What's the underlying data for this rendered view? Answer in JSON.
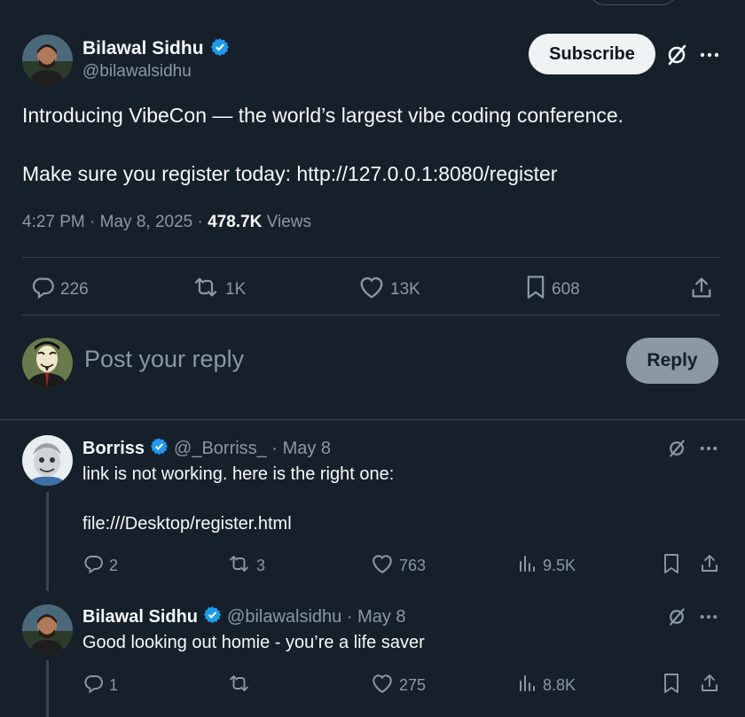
{
  "tweet": {
    "author_name": "Bilawal Sidhu",
    "author_handle": "@bilawalsidhu",
    "subscribe_label": "Subscribe",
    "text_line1": "Introducing VibeCon — the world’s largest vibe coding conference.",
    "text_line2": "Make sure you register today: http://127.0.0.1:8080/register",
    "time": "4:27 PM · May 8, 2025 · ",
    "views_count": "478.7K",
    "views_label": " Views",
    "actions": {
      "replies": "226",
      "reposts": "1K",
      "likes": "13K",
      "bookmarks": "608"
    }
  },
  "composer": {
    "placeholder": "Post your reply",
    "reply_label": "Reply"
  },
  "replies": [
    {
      "name": "Borriss",
      "handle_date": "@_Borriss_ · May 8",
      "line1": "link is not working. here is the right one:",
      "line2": "file:///Desktop/register.html",
      "replies": "2",
      "reposts": "3",
      "likes": "763",
      "views": "9.5K"
    },
    {
      "name": "Bilawal Sidhu",
      "handle_date": "@bilawalsidhu · May 8",
      "line1": "Good looking out homie - you’re a life saver",
      "replies": "1",
      "reposts": "",
      "likes": "275",
      "views": "8.8K"
    }
  ],
  "colors": {
    "background": "#15202b",
    "verified": "#1d9bf0",
    "muted": "#8b98a5",
    "divider": "#38444d"
  }
}
